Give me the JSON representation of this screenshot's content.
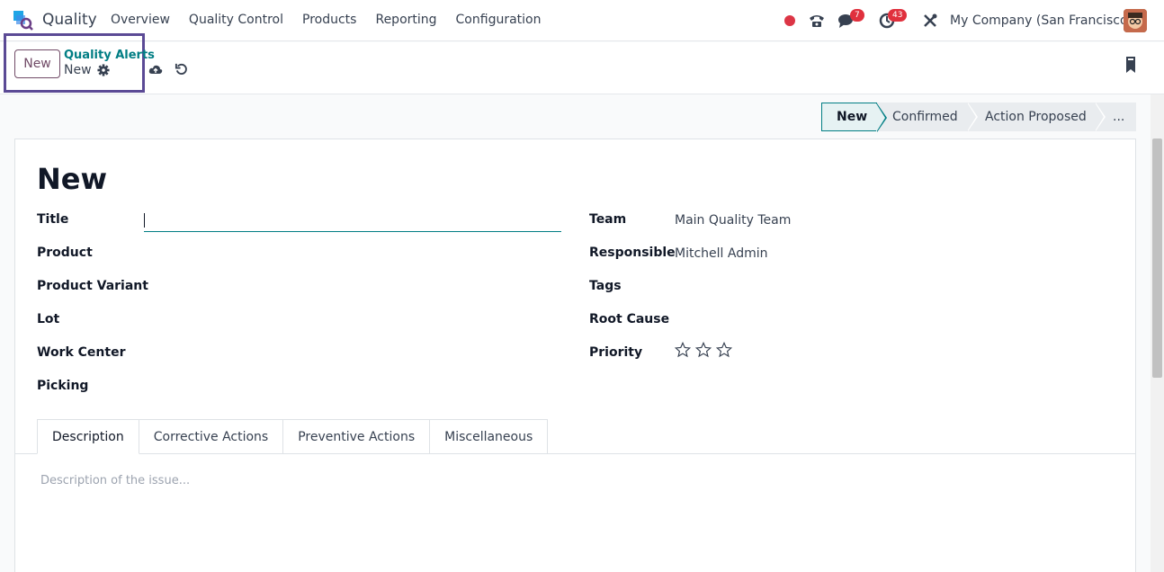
{
  "navbar": {
    "app_name": "Quality",
    "menu": [
      "Overview",
      "Quality Control",
      "Products",
      "Reporting",
      "Configuration"
    ],
    "chat_count": "7",
    "activity_count": "43",
    "company": "My Company (San Francisco)"
  },
  "control_panel": {
    "new_label": "New",
    "breadcrumb_parent": "Quality Alerts",
    "breadcrumb_current": "New"
  },
  "status_stages": [
    "New",
    "Confirmed",
    "Action Proposed",
    "..."
  ],
  "form": {
    "title": "New",
    "left_fields": [
      {
        "label": "Title",
        "value": ""
      },
      {
        "label": "Product",
        "value": ""
      },
      {
        "label": "Product Variant",
        "value": ""
      },
      {
        "label": "Lot",
        "value": ""
      },
      {
        "label": "Work Center",
        "value": ""
      },
      {
        "label": "Picking",
        "value": ""
      }
    ],
    "right_fields": [
      {
        "label": "Team",
        "value": "Main Quality Team"
      },
      {
        "label": "Responsible",
        "value": "Mitchell Admin"
      },
      {
        "label": "Tags",
        "value": ""
      },
      {
        "label": "Root Cause",
        "value": ""
      },
      {
        "label": "Priority",
        "value": ""
      }
    ],
    "priority_stars": 0,
    "priority_max": 3
  },
  "tabs": [
    "Description",
    "Corrective Actions",
    "Preventive Actions",
    "Miscellaneous"
  ],
  "description_placeholder": "Description of the issue...",
  "colors": {
    "accent": "#017e84",
    "brand": "#714b67",
    "focus": "#5b4a95"
  }
}
